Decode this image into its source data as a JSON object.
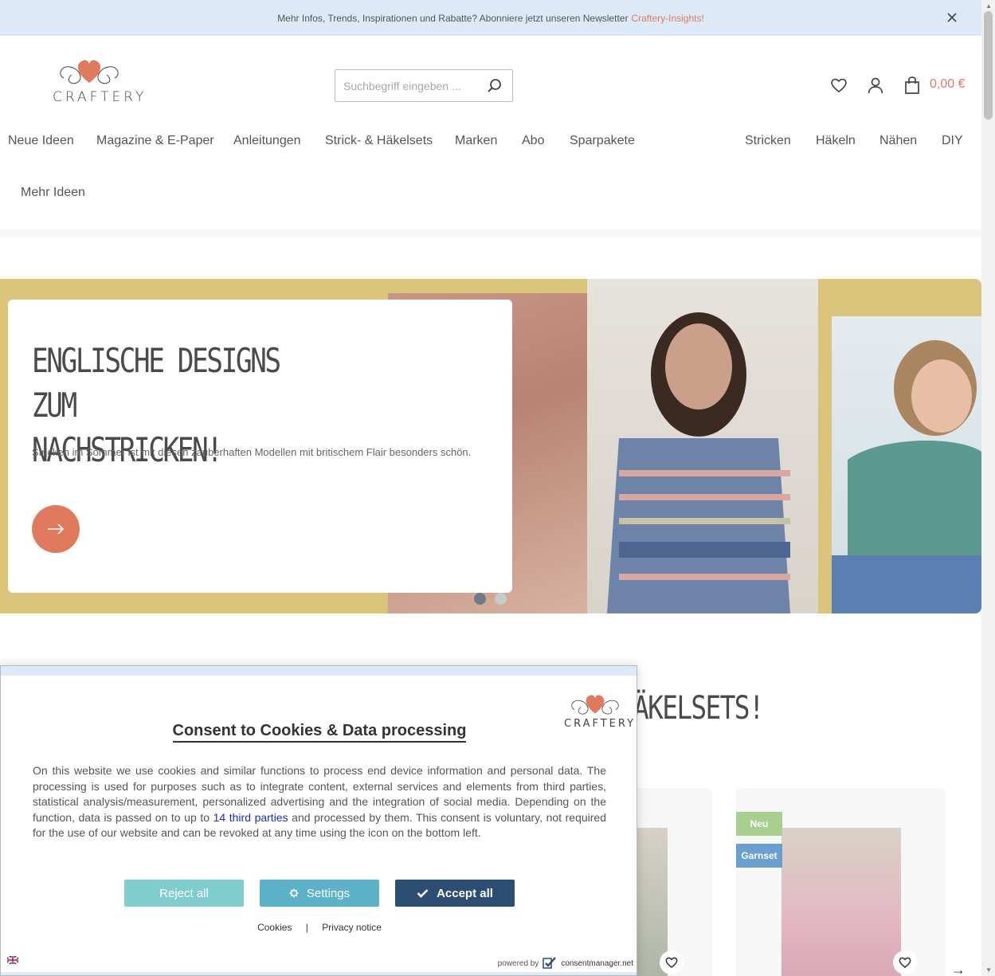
{
  "notice": {
    "text": "Mehr Infos, Trends, Inspirationen und Rabatte? Abonniere jetzt unseren Newsletter",
    "link": "Craftery-Insights!"
  },
  "header": {
    "logo_text": "CRAFTERY",
    "search_placeholder": "Suchbegriff eingeben ...",
    "cart_total": "0,00 €"
  },
  "nav": {
    "left": [
      "Neue Ideen",
      "Magazine & E-Paper",
      "Anleitungen",
      "Strick- & Häkelsets",
      "Marken",
      "Abo",
      "Sparpakete"
    ],
    "right": [
      "Stricken",
      "Häkeln",
      "Nähen",
      "DIY"
    ],
    "second_row": "Mehr Ideen"
  },
  "hero": {
    "title_line1": "ENGLISCHE DESIGNS ZUM",
    "title_line2": "NACHSTRICKEN!",
    "text": "Stricken im Sommer ist mit diesen zauberhaften Modellen mit britischem Flair besonders schön.",
    "slides_total": 2,
    "active_slide": 1
  },
  "section": {
    "title_partial": "ÄKELSETS!"
  },
  "products": {
    "badge_new": "Neu",
    "badge_type": "Garnset"
  },
  "consent": {
    "logo_text": "CRAFTERY",
    "title": "Consent to Cookies & Data processing",
    "text_before_link": "On this website we use cookies and similar functions to process end device information and personal data. The processing is used for purposes such as to integrate content, external services and elements from third parties, statistical analysis/measurement, personalized advertising and the integration of social media. Depending on the function, data is passed on to up to ",
    "link_text": "14 third parties",
    "text_after_link": " and processed by them. This consent is voluntary, not required for the use of our website and can be revoked at any time using the icon on the bottom left.",
    "reject_label": "Reject all",
    "settings_label": "Settings",
    "accept_label": "Accept all",
    "cookies_link": "Cookies",
    "separator": "|",
    "privacy_link": "Privacy notice",
    "powered_by": "powered by",
    "brand": "consentmanager.net"
  },
  "colors": {
    "accent": "#e07a5f",
    "notice_bg": "#dbeaf6",
    "hero_bg": "#d9c47a",
    "reject": "#80cdd0",
    "settings": "#5cb3c9",
    "accept": "#2b4e72",
    "badge_new": "#a8cf8f",
    "badge_type": "#6a9fcf"
  },
  "icons": {
    "close": "close-icon",
    "search": "search-icon",
    "wishlist": "heart-icon",
    "account": "user-icon",
    "cart": "shopping-bag-icon",
    "hero_arrow": "arrow-right-icon",
    "settings": "gear-icon",
    "accept": "checkmark-icon",
    "language": "flag-icon"
  }
}
